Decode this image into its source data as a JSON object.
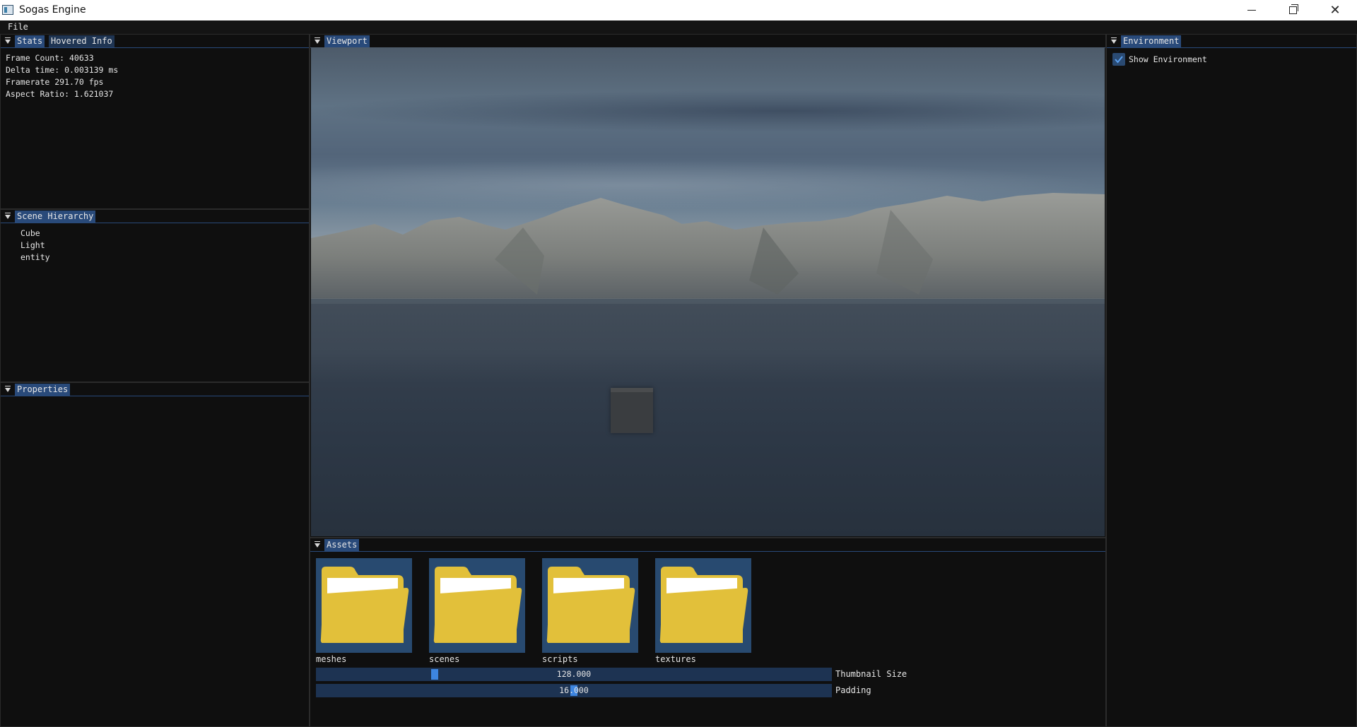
{
  "window": {
    "title": "Sogas Engine",
    "minimize_icon": "minimize-icon",
    "maximize_icon": "restore-icon",
    "close_glyph": "✕"
  },
  "menu": {
    "file": "File"
  },
  "stats_panel": {
    "tabs": [
      "Stats",
      "Hovered Info"
    ],
    "lines": [
      "Frame Count: 40633",
      "Delta time: 0.003139 ms",
      "Framerate 291.70 fps",
      "Aspect Ratio: 1.621037"
    ]
  },
  "hierarchy_panel": {
    "tab": "Scene Hierarchy",
    "items": [
      "Cube",
      "Light",
      "entity"
    ]
  },
  "properties_panel": {
    "tab": "Properties"
  },
  "viewport_panel": {
    "tab": "Viewport"
  },
  "environment_panel": {
    "tab": "Environment",
    "show_environment_label": "Show Environment",
    "show_environment_checked": true
  },
  "assets_panel": {
    "tab": "Assets",
    "folders": [
      "meshes",
      "scenes",
      "scripts",
      "textures"
    ],
    "folder_icon": "folder-icon",
    "thumbnail_size": {
      "value": "128.000",
      "label": "Thumbnail Size"
    },
    "padding": {
      "value": "16.000",
      "label": "Padding"
    }
  },
  "colors": {
    "accent": "#294a7a",
    "accent_inactive": "#1f3553",
    "slider_grab": "#3d85e0",
    "folder_yellow": "#e2c03a",
    "background": "#0f0f0f"
  }
}
